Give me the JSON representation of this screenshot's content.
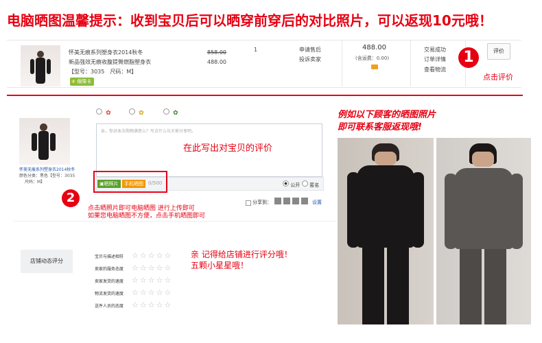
{
  "banner": "电脑晒图温馨提示：收到宝贝后可以晒穿前穿后的对比照片，可以返现10元哦！",
  "order": {
    "title_line1": "怀美无痕系列塑身衣2014秋冬",
    "title_line2": "新品强效无痕收腹提臀燃脂塑身衣",
    "model": "【型号：3035　尺码：M】",
    "badge": "保障卡",
    "price_original": "858.00",
    "price_current": "488.00",
    "qty": "1",
    "apply_after_sale": "申请售后",
    "complain": "投诉卖家",
    "total": "488.00",
    "shipping": "(含运费：0.00)",
    "status_success": "交易成功",
    "order_details": "订单详情",
    "view_logistics": "查看物流",
    "review_button": "评价"
  },
  "step1": {
    "number": "1",
    "caption": "点击评价"
  },
  "review": {
    "product_title": "怀美无痕系列塑身衣2014秋冬",
    "product_meta1": "颜色分类：黑色【型号：3035",
    "product_meta2": "尺码：M】",
    "textarea_placeholder": "亲，你对本次购物满意么？写点什么与大家分享吧。",
    "textarea_hint": "在此写出对宝贝的评价",
    "upload_photo": "晒照片",
    "mobile_photo": "手机晒图",
    "char_count": "0/500",
    "visibility_public": "公开",
    "visibility_anon": "匿名",
    "share_label": "分享到：",
    "settings": "设置"
  },
  "step2": {
    "number": "2",
    "caption_line1": "点击晒照片即可电脑晒图 进行上传即可",
    "caption_line2": "如果您电脑晒图不方便，点击手机晒图即可"
  },
  "example": {
    "line1": "例如以下顾客的晒图照片",
    "line2": "即可联系客服返现哦!"
  },
  "shop_rating": {
    "label": "店铺动态评分",
    "items": [
      "宝贝与描述相符",
      "卖家的服务态度",
      "卖家发货的速度",
      "物流发货的速度",
      "送件人员的态度"
    ],
    "stars": "☆☆☆☆☆",
    "reminder_line1": "亲 记得给店铺进行评分哦！",
    "reminder_line2": "五颗小星星哦！"
  },
  "colors": {
    "accent": "#e60012",
    "orange": "#f39800",
    "green": "#5aa02c"
  }
}
